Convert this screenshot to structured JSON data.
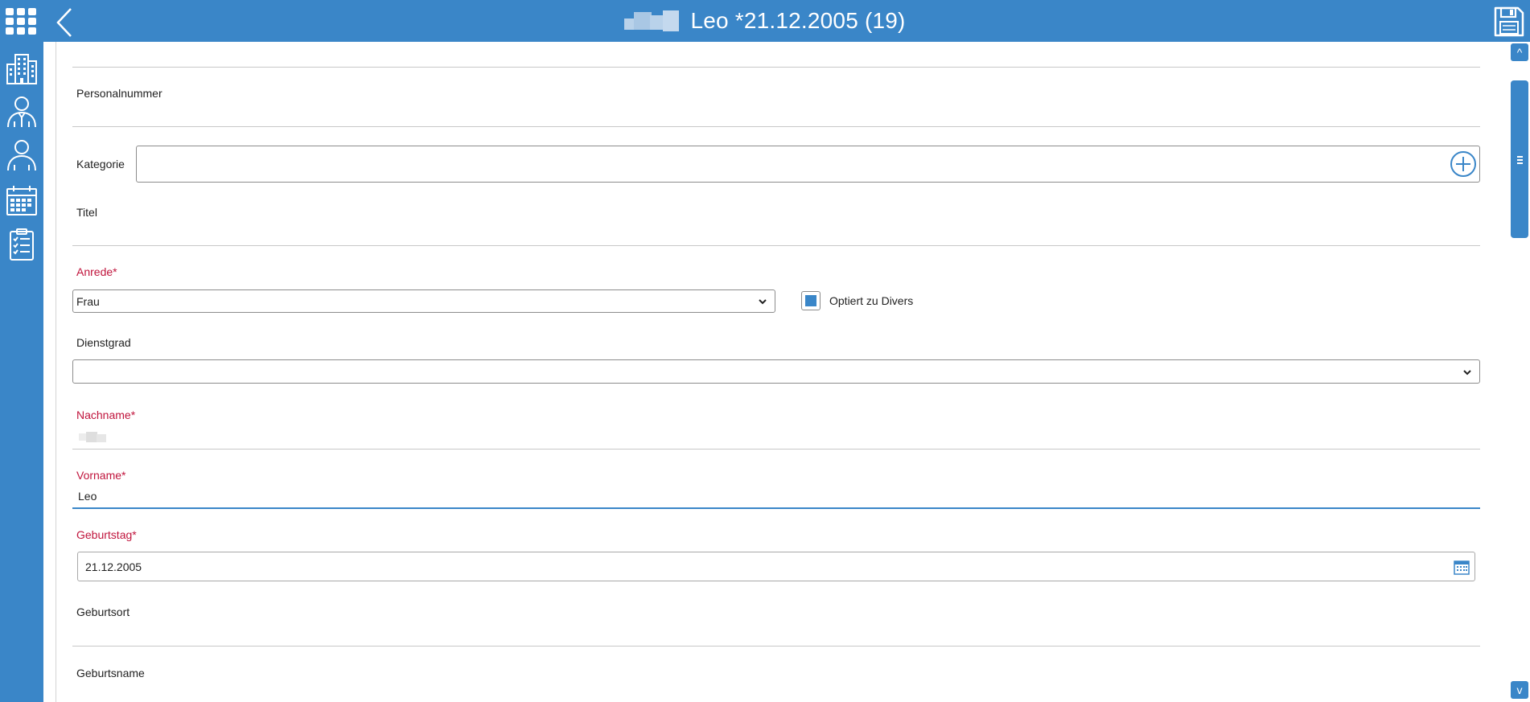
{
  "header": {
    "title": "Leo *21.12.2005 (19)",
    "apps_icon": "grid-icon",
    "back_icon": "chevron-left-icon",
    "save_icon": "floppy-disk-icon"
  },
  "sidebar": {
    "items": [
      {
        "icon": "building-icon"
      },
      {
        "icon": "employee-icon"
      },
      {
        "icon": "person-icon"
      },
      {
        "icon": "calendar-icon"
      },
      {
        "icon": "clipboard-checklist-icon"
      }
    ]
  },
  "form": {
    "personalnummer_label": "Personalnummer",
    "kategorie_label": "Kategorie",
    "kategorie_value": "",
    "titel_label": "Titel",
    "anrede_label": "Anrede*",
    "anrede_value": "Frau",
    "divers_label": "Optiert zu Divers",
    "dienstgrad_label": "Dienstgrad",
    "dienstgrad_value": "",
    "nachname_label": "Nachname*",
    "vorname_label": "Vorname*",
    "vorname_value": "Leo",
    "geburtstag_label": "Geburtstag*",
    "geburtstag_value": "21.12.2005",
    "geburtsort_label": "Geburtsort",
    "geburtsname_label": "Geburtsname"
  },
  "scrollbar": {
    "up_label": "^",
    "down_label": "v"
  },
  "colors": {
    "accent": "#3a86c8",
    "required": "#c0143c"
  }
}
